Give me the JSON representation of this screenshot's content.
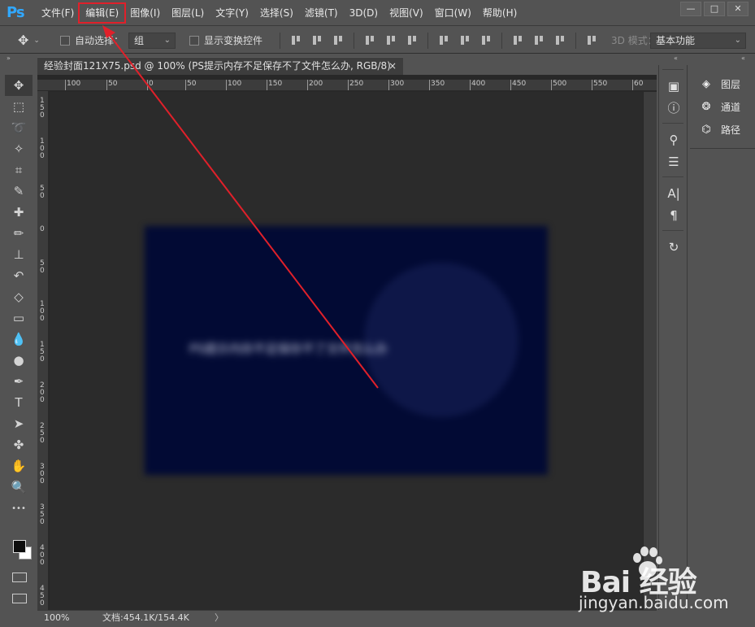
{
  "app": {
    "logo": "Ps"
  },
  "menu": [
    {
      "label": "文件(F)"
    },
    {
      "label": "编辑(E)"
    },
    {
      "label": "图像(I)"
    },
    {
      "label": "图层(L)"
    },
    {
      "label": "文字(Y)"
    },
    {
      "label": "选择(S)"
    },
    {
      "label": "滤镜(T)"
    },
    {
      "label": "3D(D)"
    },
    {
      "label": "视图(V)"
    },
    {
      "label": "窗口(W)"
    },
    {
      "label": "帮助(H)"
    }
  ],
  "window_controls": {
    "minimize": "—",
    "maximize": "□",
    "close": "✕"
  },
  "options": {
    "auto_select_label": "自动选择：",
    "auto_select_value": "组",
    "show_transform_label": "显示变换控件",
    "mode_3d_label": "3D 模式：",
    "workspace_value": "基本功能"
  },
  "document": {
    "tab_title": "经验封面121X75.psd @ 100% (PS提示内存不足保存不了文件怎么办, RGB/8)",
    "tab_close": "×",
    "canvas_text": "PS提示内存不足保存不了文件怎么办"
  },
  "ruler_top": [
    "100",
    "50",
    "0",
    "50",
    "100",
    "150",
    "200",
    "250",
    "300",
    "350",
    "400",
    "450",
    "500",
    "550",
    "60"
  ],
  "ruler_left": [
    "150",
    "100",
    "50",
    "0",
    "50",
    "100",
    "150",
    "200",
    "250",
    "300",
    "350",
    "400",
    "450"
  ],
  "tools": [
    {
      "name": "move-tool-icon",
      "glyph": "✥"
    },
    {
      "name": "marquee-tool-icon",
      "glyph": "⬚"
    },
    {
      "name": "lasso-tool-icon",
      "glyph": "➰"
    },
    {
      "name": "magic-wand-tool-icon",
      "glyph": "✧"
    },
    {
      "name": "crop-tool-icon",
      "glyph": "⌗"
    },
    {
      "name": "eyedropper-tool-icon",
      "glyph": "✎"
    },
    {
      "name": "healing-brush-tool-icon",
      "glyph": "✚"
    },
    {
      "name": "brush-tool-icon",
      "glyph": "✏"
    },
    {
      "name": "clone-stamp-tool-icon",
      "glyph": "⊥"
    },
    {
      "name": "history-brush-tool-icon",
      "glyph": "↶"
    },
    {
      "name": "eraser-tool-icon",
      "glyph": "◇"
    },
    {
      "name": "gradient-tool-icon",
      "glyph": "▭"
    },
    {
      "name": "blur-tool-icon",
      "glyph": "💧"
    },
    {
      "name": "dodge-tool-icon",
      "glyph": "●"
    },
    {
      "name": "pen-tool-icon",
      "glyph": "✒"
    },
    {
      "name": "type-tool-icon",
      "glyph": "T"
    },
    {
      "name": "path-selection-tool-icon",
      "glyph": "➤"
    },
    {
      "name": "shape-tool-icon",
      "glyph": "✤"
    },
    {
      "name": "hand-tool-icon",
      "glyph": "✋"
    },
    {
      "name": "zoom-tool-icon",
      "glyph": "🔍"
    },
    {
      "name": "more-tools-icon",
      "glyph": "•••"
    }
  ],
  "status": {
    "zoom": "100%",
    "doc_info": "文档:454.1K/154.4K",
    "arrow": "〉"
  },
  "panels": [
    {
      "icon": "◈",
      "label": "图层"
    },
    {
      "icon": "❂",
      "label": "通道"
    },
    {
      "icon": "⌬",
      "label": "路径"
    }
  ],
  "side_icons": [
    "▣",
    "ⓘ",
    "⚲",
    "☰",
    "A|",
    "¶",
    "↻"
  ],
  "watermark": {
    "brand": "Bai  经验",
    "url": "jingyan.baidu.com"
  },
  "colors": {
    "highlight": "#e0202a",
    "canvas_bg": "#020a34",
    "ps_blue": "#31a8ff"
  }
}
